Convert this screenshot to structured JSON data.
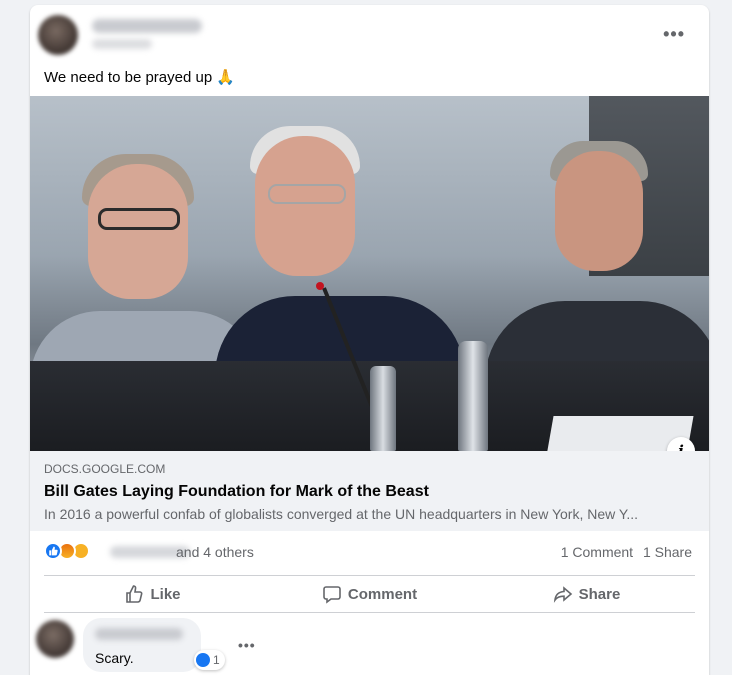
{
  "post": {
    "text": "We need to be prayed up 🙏",
    "more_label": "•••"
  },
  "link_preview": {
    "domain": "DOCS.GOOGLE.COM",
    "title": "Bill Gates Laying Foundation for Mark of the Beast",
    "description": "In 2016 a powerful confab of globalists converged at the UN headquarters in New York, New Y...",
    "info_label": "i"
  },
  "reactions": {
    "others": "and 4 others",
    "comments": "1 Comment",
    "shares": "1 Share"
  },
  "actions": {
    "like": "Like",
    "comment": "Comment",
    "share": "Share"
  },
  "comment": {
    "text": "Scary.",
    "reaction_count": "1",
    "more_label": "•••"
  },
  "colors": {
    "accent": "#1877f2",
    "secondary_text": "#65676b",
    "link_box_bg": "#f0f2f5"
  },
  "icons": [
    "more-options-icon",
    "info-icon",
    "like-reaction-icon",
    "angry-reaction-icon",
    "sad-reaction-icon",
    "thumbs-up-icon",
    "comment-icon",
    "share-icon"
  ]
}
